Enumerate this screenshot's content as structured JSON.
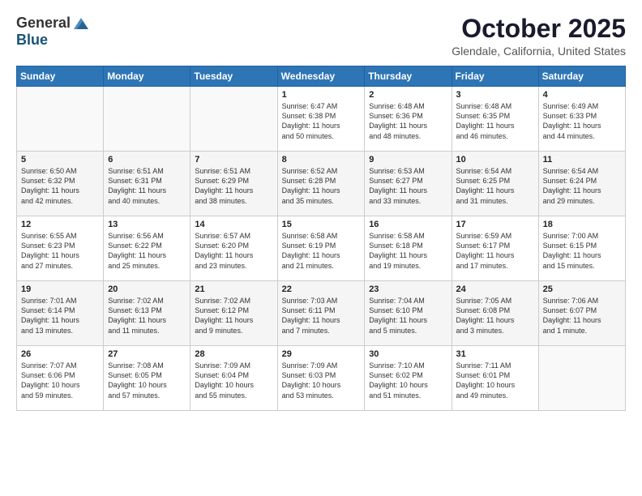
{
  "header": {
    "logo_general": "General",
    "logo_blue": "Blue",
    "month_title": "October 2025",
    "location": "Glendale, California, United States"
  },
  "weekdays": [
    "Sunday",
    "Monday",
    "Tuesday",
    "Wednesday",
    "Thursday",
    "Friday",
    "Saturday"
  ],
  "weeks": [
    [
      {
        "day": "",
        "info": ""
      },
      {
        "day": "",
        "info": ""
      },
      {
        "day": "",
        "info": ""
      },
      {
        "day": "1",
        "info": "Sunrise: 6:47 AM\nSunset: 6:38 PM\nDaylight: 11 hours\nand 50 minutes."
      },
      {
        "day": "2",
        "info": "Sunrise: 6:48 AM\nSunset: 6:36 PM\nDaylight: 11 hours\nand 48 minutes."
      },
      {
        "day": "3",
        "info": "Sunrise: 6:48 AM\nSunset: 6:35 PM\nDaylight: 11 hours\nand 46 minutes."
      },
      {
        "day": "4",
        "info": "Sunrise: 6:49 AM\nSunset: 6:33 PM\nDaylight: 11 hours\nand 44 minutes."
      }
    ],
    [
      {
        "day": "5",
        "info": "Sunrise: 6:50 AM\nSunset: 6:32 PM\nDaylight: 11 hours\nand 42 minutes."
      },
      {
        "day": "6",
        "info": "Sunrise: 6:51 AM\nSunset: 6:31 PM\nDaylight: 11 hours\nand 40 minutes."
      },
      {
        "day": "7",
        "info": "Sunrise: 6:51 AM\nSunset: 6:29 PM\nDaylight: 11 hours\nand 38 minutes."
      },
      {
        "day": "8",
        "info": "Sunrise: 6:52 AM\nSunset: 6:28 PM\nDaylight: 11 hours\nand 35 minutes."
      },
      {
        "day": "9",
        "info": "Sunrise: 6:53 AM\nSunset: 6:27 PM\nDaylight: 11 hours\nand 33 minutes."
      },
      {
        "day": "10",
        "info": "Sunrise: 6:54 AM\nSunset: 6:25 PM\nDaylight: 11 hours\nand 31 minutes."
      },
      {
        "day": "11",
        "info": "Sunrise: 6:54 AM\nSunset: 6:24 PM\nDaylight: 11 hours\nand 29 minutes."
      }
    ],
    [
      {
        "day": "12",
        "info": "Sunrise: 6:55 AM\nSunset: 6:23 PM\nDaylight: 11 hours\nand 27 minutes."
      },
      {
        "day": "13",
        "info": "Sunrise: 6:56 AM\nSunset: 6:22 PM\nDaylight: 11 hours\nand 25 minutes."
      },
      {
        "day": "14",
        "info": "Sunrise: 6:57 AM\nSunset: 6:20 PM\nDaylight: 11 hours\nand 23 minutes."
      },
      {
        "day": "15",
        "info": "Sunrise: 6:58 AM\nSunset: 6:19 PM\nDaylight: 11 hours\nand 21 minutes."
      },
      {
        "day": "16",
        "info": "Sunrise: 6:58 AM\nSunset: 6:18 PM\nDaylight: 11 hours\nand 19 minutes."
      },
      {
        "day": "17",
        "info": "Sunrise: 6:59 AM\nSunset: 6:17 PM\nDaylight: 11 hours\nand 17 minutes."
      },
      {
        "day": "18",
        "info": "Sunrise: 7:00 AM\nSunset: 6:15 PM\nDaylight: 11 hours\nand 15 minutes."
      }
    ],
    [
      {
        "day": "19",
        "info": "Sunrise: 7:01 AM\nSunset: 6:14 PM\nDaylight: 11 hours\nand 13 minutes."
      },
      {
        "day": "20",
        "info": "Sunrise: 7:02 AM\nSunset: 6:13 PM\nDaylight: 11 hours\nand 11 minutes."
      },
      {
        "day": "21",
        "info": "Sunrise: 7:02 AM\nSunset: 6:12 PM\nDaylight: 11 hours\nand 9 minutes."
      },
      {
        "day": "22",
        "info": "Sunrise: 7:03 AM\nSunset: 6:11 PM\nDaylight: 11 hours\nand 7 minutes."
      },
      {
        "day": "23",
        "info": "Sunrise: 7:04 AM\nSunset: 6:10 PM\nDaylight: 11 hours\nand 5 minutes."
      },
      {
        "day": "24",
        "info": "Sunrise: 7:05 AM\nSunset: 6:08 PM\nDaylight: 11 hours\nand 3 minutes."
      },
      {
        "day": "25",
        "info": "Sunrise: 7:06 AM\nSunset: 6:07 PM\nDaylight: 11 hours\nand 1 minute."
      }
    ],
    [
      {
        "day": "26",
        "info": "Sunrise: 7:07 AM\nSunset: 6:06 PM\nDaylight: 10 hours\nand 59 minutes."
      },
      {
        "day": "27",
        "info": "Sunrise: 7:08 AM\nSunset: 6:05 PM\nDaylight: 10 hours\nand 57 minutes."
      },
      {
        "day": "28",
        "info": "Sunrise: 7:09 AM\nSunset: 6:04 PM\nDaylight: 10 hours\nand 55 minutes."
      },
      {
        "day": "29",
        "info": "Sunrise: 7:09 AM\nSunset: 6:03 PM\nDaylight: 10 hours\nand 53 minutes."
      },
      {
        "day": "30",
        "info": "Sunrise: 7:10 AM\nSunset: 6:02 PM\nDaylight: 10 hours\nand 51 minutes."
      },
      {
        "day": "31",
        "info": "Sunrise: 7:11 AM\nSunset: 6:01 PM\nDaylight: 10 hours\nand 49 minutes."
      },
      {
        "day": "",
        "info": ""
      }
    ]
  ]
}
